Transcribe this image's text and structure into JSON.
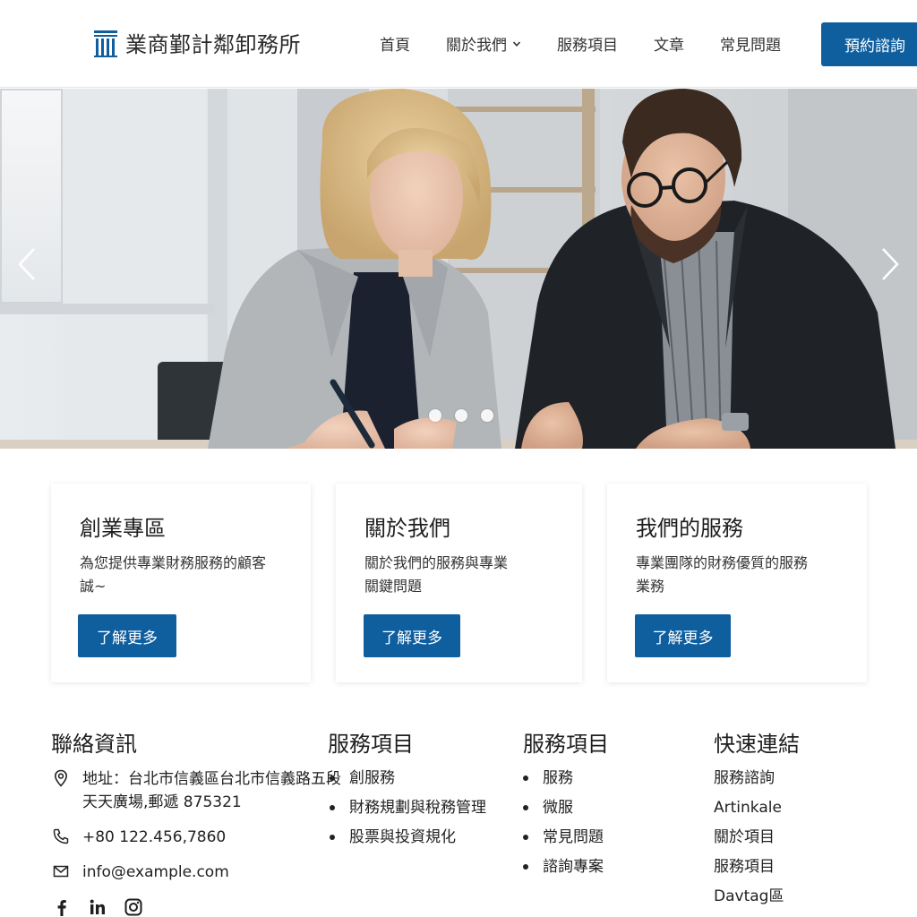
{
  "header": {
    "logo_text": "業商鄞計鄰卸務所",
    "nav": [
      {
        "label": "首頁"
      },
      {
        "label": "關於我們"
      },
      {
        "label": "服務項目"
      },
      {
        "label": "文章"
      },
      {
        "label": "常見問題"
      }
    ],
    "cta_label": "預約諮詢"
  },
  "hero": {
    "dot_count": 3,
    "active_slide": 1
  },
  "cards": [
    {
      "title": "創業專區",
      "desc": "為您提供專業財務服務的顧客",
      "desc2": "誠~",
      "button": "了解更多"
    },
    {
      "title": "關於我們",
      "desc": "關於我們的服務與專業",
      "desc2": "關鍵問題",
      "button": "了解更多"
    },
    {
      "title": "我們的服務",
      "desc": "專業團隊的財務優質的服務",
      "desc2": "業務",
      "button": "了解更多"
    }
  ],
  "footer": {
    "contact": {
      "heading": "聯絡資訊",
      "address_line1": "地址：台北市信義區台北市信義路五段",
      "address_line2": "天天廣場,郵遞 875321",
      "phone": "+80 122.456,7860",
      "email": "info@example.com"
    },
    "services1": {
      "heading": "服務項目",
      "items": [
        "創服務",
        "財務規劃與稅務管理",
        "股票與投資規化"
      ]
    },
    "services2": {
      "heading": "服務項目",
      "items": [
        "服務",
        "微服",
        "常見問題",
        "諮詢專案"
      ]
    },
    "quick": {
      "heading": "快速連結",
      "items": [
        "服務諮詢",
        "Artinkale",
        "關於項目",
        "服務項目",
        "Davtag區"
      ]
    }
  }
}
